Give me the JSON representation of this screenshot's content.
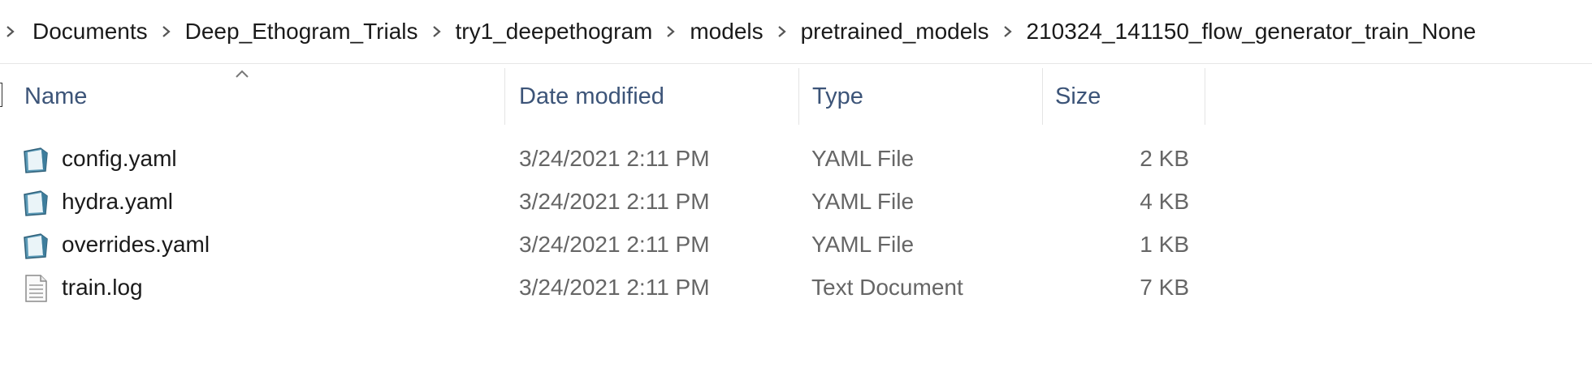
{
  "breadcrumb": [
    "Documents",
    "Deep_Ethogram_Trials",
    "try1_deepethogram",
    "models",
    "pretrained_models",
    "210324_141150_flow_generator_train_None"
  ],
  "columns": {
    "name": "Name",
    "date_modified": "Date modified",
    "type": "Type",
    "size": "Size"
  },
  "sort": {
    "column": "Name",
    "direction": "ascending"
  },
  "files": [
    {
      "name": "config.yaml",
      "date": "3/24/2021 2:11 PM",
      "type": "YAML File",
      "size": "2 KB",
      "icon": "yaml-file-icon"
    },
    {
      "name": "hydra.yaml",
      "date": "3/24/2021 2:11 PM",
      "type": "YAML File",
      "size": "4 KB",
      "icon": "yaml-file-icon"
    },
    {
      "name": "overrides.yaml",
      "date": "3/24/2021 2:11 PM",
      "type": "YAML File",
      "size": "1 KB",
      "icon": "yaml-file-icon"
    },
    {
      "name": "train.log",
      "date": "3/24/2021 2:11 PM",
      "type": "Text Document",
      "size": "7 KB",
      "icon": "text-file-icon"
    }
  ],
  "colors": {
    "header_text": "#3c5478",
    "body_text": "#1a1a1a",
    "meta_text": "#666666"
  }
}
